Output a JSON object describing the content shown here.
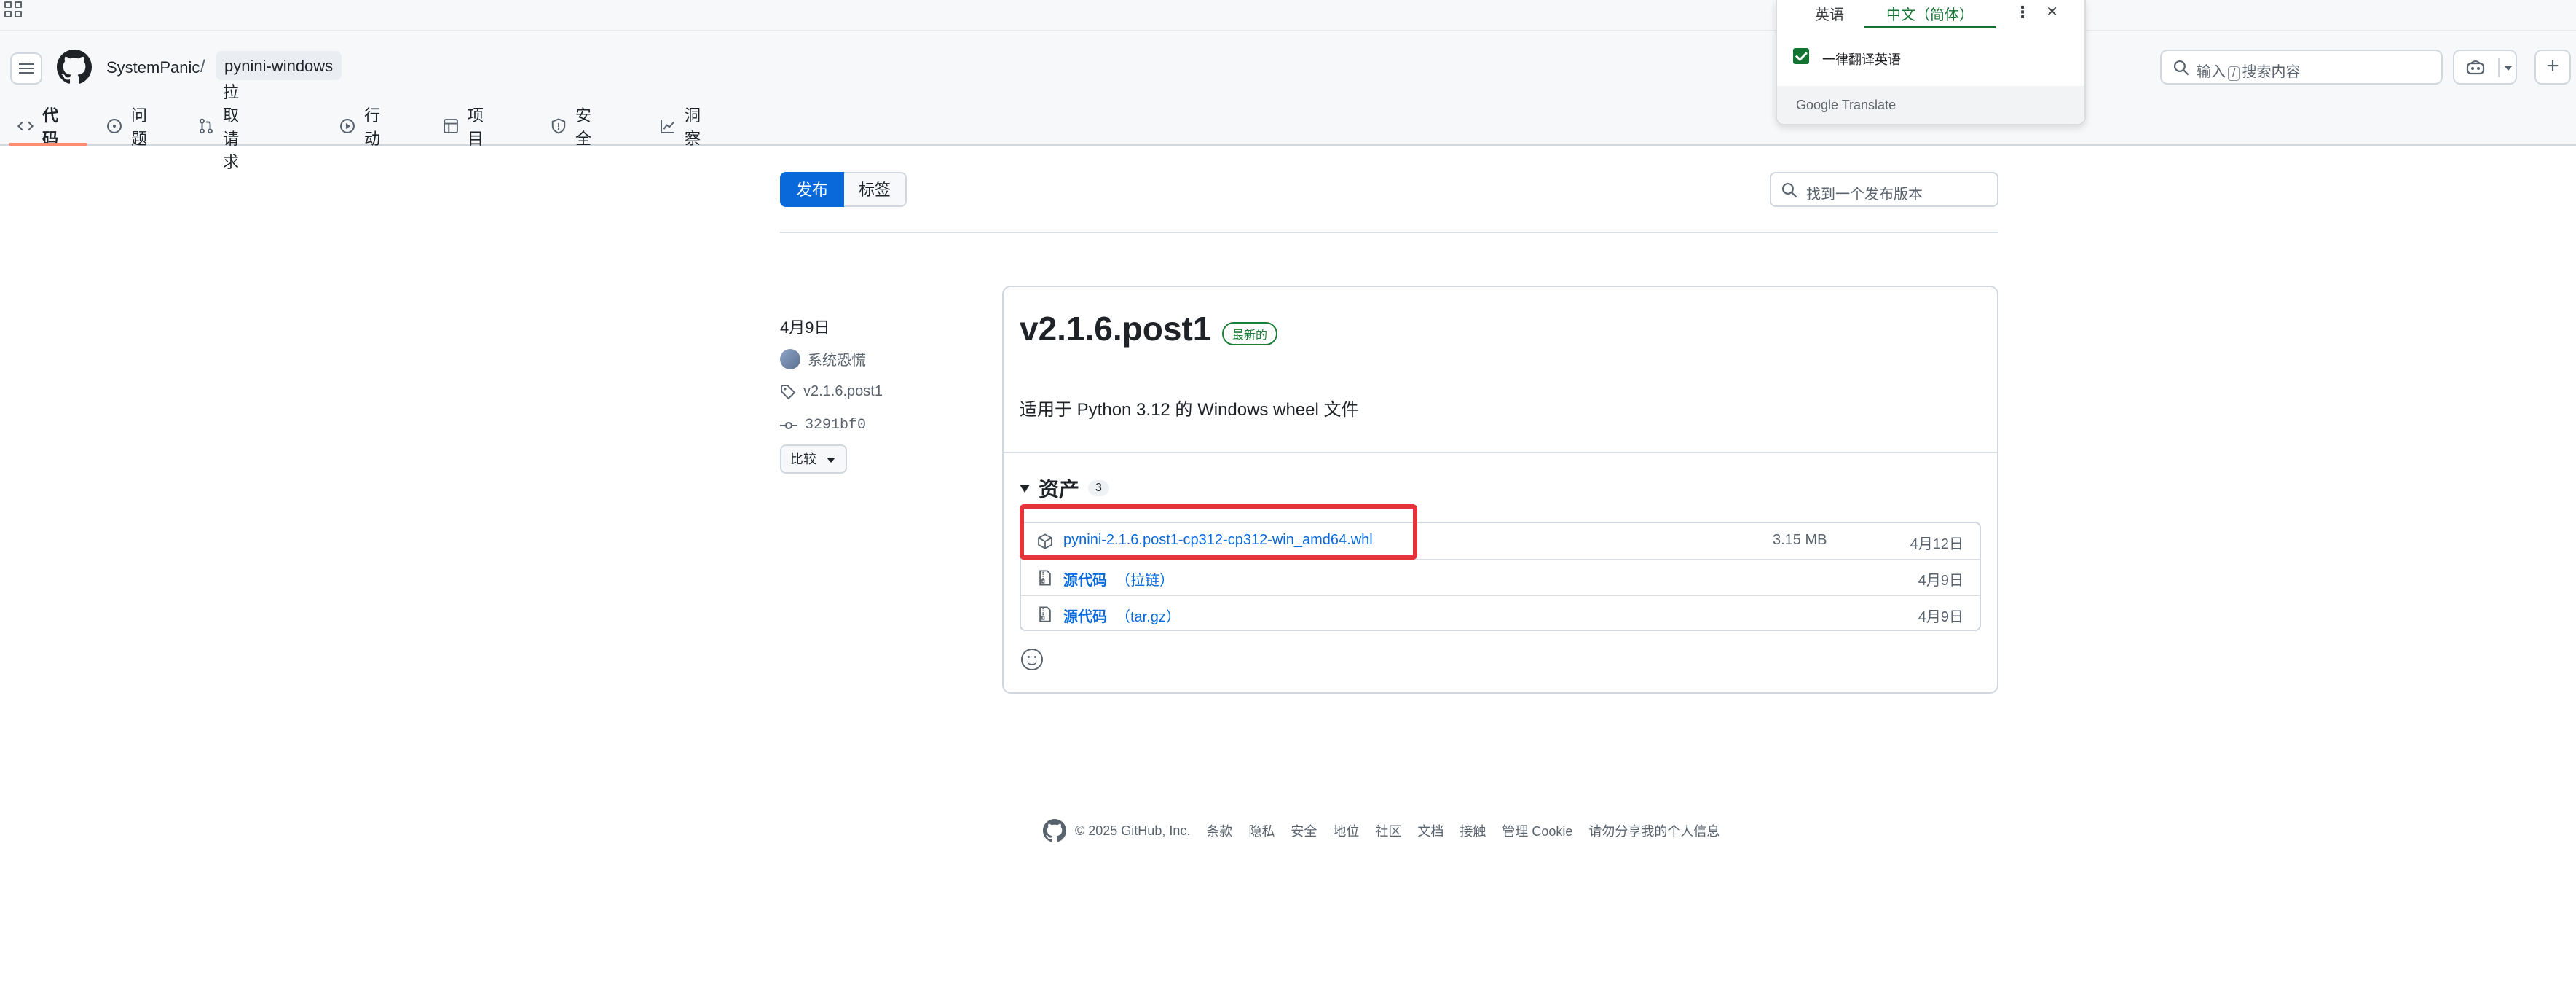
{
  "translate": {
    "tab_source": "英语",
    "tab_target": "中文（简体）",
    "always_translate": "一律翻译英语",
    "brand": "Google Translate"
  },
  "header": {
    "owner": "SystemPanic",
    "separator": "/",
    "repo": "pynini-windows",
    "search_placeholder_pre": "输入",
    "search_key": "/",
    "search_placeholder_post": "搜索内容",
    "plus": "+"
  },
  "nav": [
    {
      "label": "代码",
      "icon": "code-icon"
    },
    {
      "label": "问题",
      "icon": "issue-icon"
    },
    {
      "label": "拉取请求",
      "icon": "pull-request-icon"
    },
    {
      "label": "行动",
      "icon": "play-icon"
    },
    {
      "label": "项目",
      "icon": "table-icon"
    },
    {
      "label": "安全",
      "icon": "shield-icon"
    },
    {
      "label": "洞察",
      "icon": "graph-icon"
    }
  ],
  "releases": {
    "tab_releases": "发布",
    "tab_tags": "标签",
    "find_placeholder": "找到一个发布版本"
  },
  "release": {
    "date": "4月9日",
    "author": "系统恐慌",
    "tag": "v2.1.6.post1",
    "commit": "3291bf0",
    "compare": "比较",
    "title": "v2.1.6.post1",
    "badge": "最新的",
    "description": "适用于 Python 3.12 的 Windows wheel 文件",
    "assets_label": "资产",
    "assets_count": "3",
    "assets": [
      {
        "name": "pynini-2.1.6.post1-cp312-cp312-win_amd64.whl",
        "size": "3.15 MB",
        "date": "4月12日"
      },
      {
        "name": "源代码",
        "ext": "（拉链）",
        "date": "4月9日"
      },
      {
        "name": "源代码",
        "ext": "（tar.gz）",
        "date": "4月9日"
      }
    ]
  },
  "footer": {
    "copyright": "© 2025 GitHub, Inc.",
    "links": [
      "条款",
      "隐私",
      "安全",
      "地位",
      "社区",
      "文档",
      "接触",
      "管理 Cookie",
      "请勿分享我的个人信息"
    ]
  }
}
